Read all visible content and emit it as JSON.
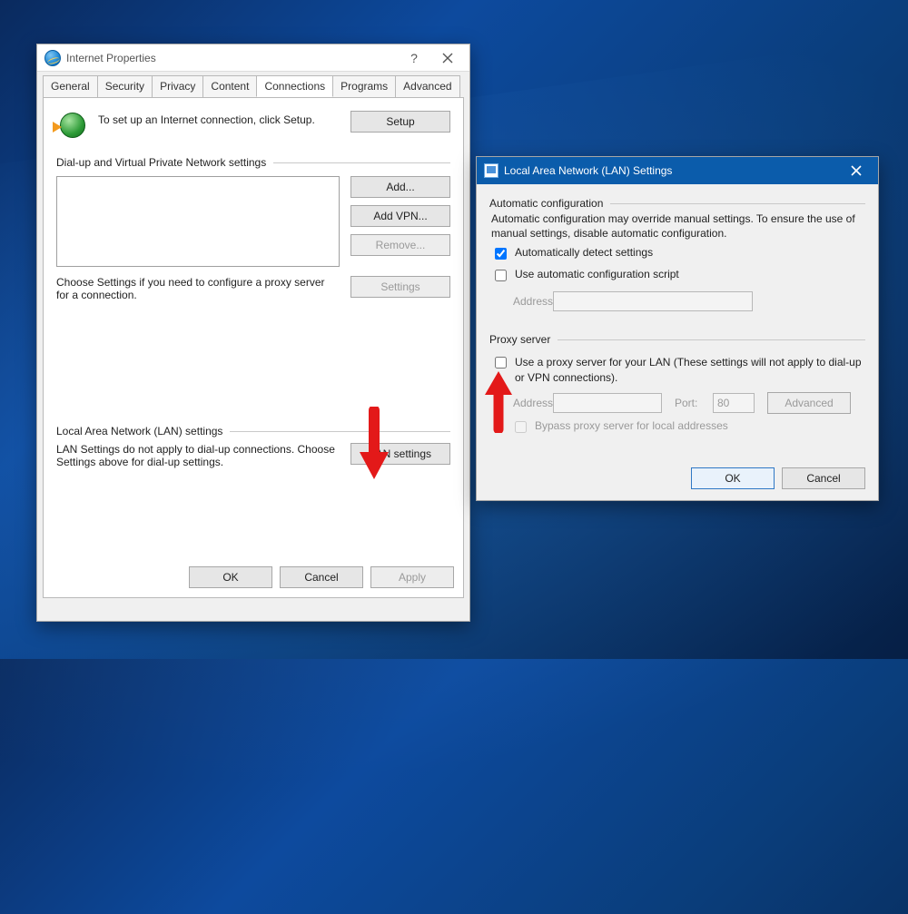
{
  "inet": {
    "title": "Internet Properties",
    "tabs": {
      "general": "General",
      "security": "Security",
      "privacy": "Privacy",
      "content": "Content",
      "connections": "Connections",
      "programs": "Programs",
      "advanced": "Advanced"
    },
    "setup_text": "To set up an Internet connection, click Setup.",
    "setup_btn": "Setup",
    "dialup_label": "Dial-up and Virtual Private Network settings",
    "btn_add": "Add...",
    "btn_addvpn": "Add VPN...",
    "btn_remove": "Remove...",
    "choose_text": "Choose Settings if you need to configure a proxy server for a connection.",
    "btn_settings": "Settings",
    "lan_label": "Local Area Network (LAN) settings",
    "lan_text": "LAN Settings do not apply to dial-up connections. Choose Settings above for dial-up settings.",
    "btn_lan": "LAN settings",
    "btn_ok": "OK",
    "btn_cancel": "Cancel",
    "btn_apply": "Apply"
  },
  "lan": {
    "title": "Local Area Network (LAN) Settings",
    "auto_label": "Automatic configuration",
    "auto_text": "Automatic configuration may override manual settings.  To ensure the use of manual settings, disable automatic configuration.",
    "auto_detect": "Automatically detect settings",
    "auto_script": "Use automatic configuration script",
    "addr_label": "Address",
    "proxy_label": "Proxy server",
    "proxy_text": "Use a proxy server for your LAN (These settings will not apply to dial-up or VPN connections).",
    "proxy_addr": "Address:",
    "proxy_port": "Port:",
    "port_value": "80",
    "btn_adv": "Advanced",
    "bypass": "Bypass proxy server for local addresses",
    "btn_ok": "OK",
    "btn_cancel": "Cancel"
  }
}
